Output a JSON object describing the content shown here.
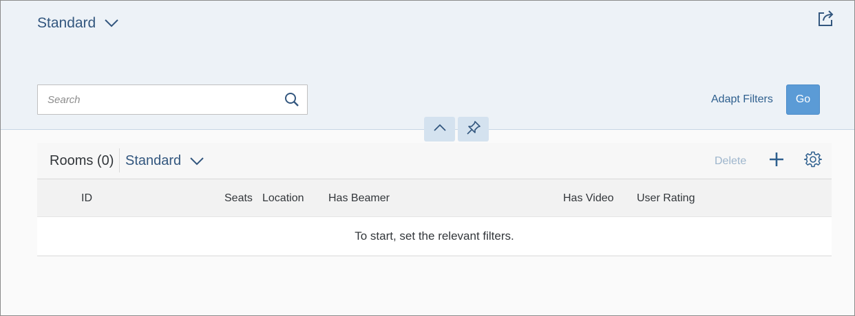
{
  "header": {
    "variant_title": "Standard",
    "search_placeholder": "Search",
    "search_value": "",
    "adapt_filters_label": "Adapt Filters",
    "go_label": "Go"
  },
  "table": {
    "title": "Rooms (0)",
    "variant_title": "Standard",
    "delete_label": "Delete",
    "columns": [
      "ID",
      "Seats",
      "Location",
      "Has Beamer",
      "Has Video",
      "User Rating"
    ],
    "empty_text": "To start, set the relevant filters."
  },
  "icons": {
    "variant_chevron": "chevron-down-icon",
    "share": "share-icon",
    "search": "search-icon",
    "collapse": "chevron-up-icon",
    "pin": "pin-icon",
    "add": "add-icon",
    "settings": "gear-icon"
  },
  "colors": {
    "header_bg": "#edf2f7",
    "accent": "#5b9bd6",
    "link": "#2e5f8e",
    "variant_text": "#32567e",
    "toolbar_button_bg": "#d4e2ef",
    "disabled_text": "#9db5cc"
  }
}
